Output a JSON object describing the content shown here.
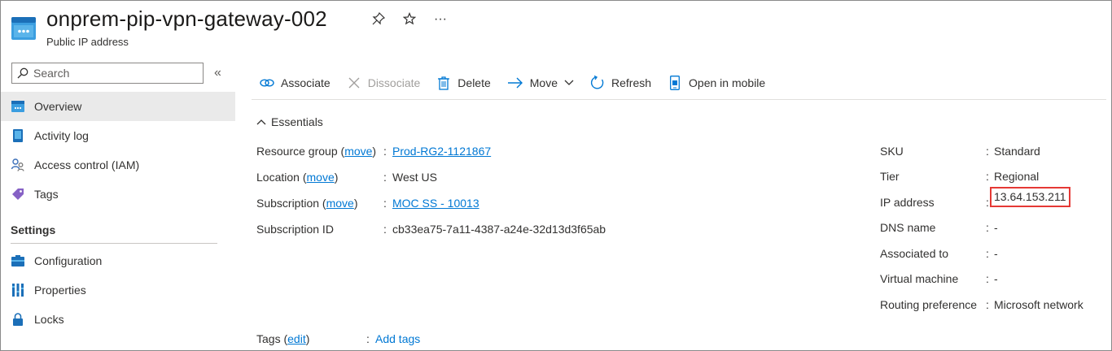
{
  "header": {
    "title": "onprem-pip-vpn-gateway-002",
    "subtitle": "Public IP address",
    "icons": [
      "pin-icon",
      "star-icon",
      "more-icon"
    ]
  },
  "sidebar": {
    "search_placeholder": "Search",
    "items": [
      {
        "label": "Overview",
        "icon": "overview-icon",
        "active": true
      },
      {
        "label": "Activity log",
        "icon": "activity-log-icon"
      },
      {
        "label": "Access control (IAM)",
        "icon": "iam-icon"
      },
      {
        "label": "Tags",
        "icon": "tag-icon"
      }
    ],
    "section_settings": "Settings",
    "settings_items": [
      {
        "label": "Configuration",
        "icon": "configuration-icon"
      },
      {
        "label": "Properties",
        "icon": "properties-icon"
      },
      {
        "label": "Locks",
        "icon": "lock-icon"
      }
    ]
  },
  "toolbar": {
    "associate": "Associate",
    "dissociate": "Dissociate",
    "delete": "Delete",
    "move": "Move",
    "refresh": "Refresh",
    "open_mobile": "Open in mobile"
  },
  "essentials": {
    "label": "Essentials",
    "left": {
      "resource_group_label": "Resource group",
      "resource_group_move": "move",
      "resource_group_value": "Prod-RG2-1121867",
      "location_label": "Location",
      "location_move": "move",
      "location_value": "West US",
      "subscription_label": "Subscription",
      "subscription_move": "move",
      "subscription_value": "MOC SS - 10013",
      "subscription_id_label": "Subscription ID",
      "subscription_id_value": "cb33ea75-7a11-4387-a24e-32d13d3f65ab"
    },
    "right": {
      "sku_label": "SKU",
      "sku_value": "Standard",
      "tier_label": "Tier",
      "tier_value": "Regional",
      "ip_label": "IP address",
      "ip_value": "13.64.153.211",
      "dns_label": "DNS name",
      "dns_value": "-",
      "associated_label": "Associated to",
      "associated_value": "-",
      "vm_label": "Virtual machine",
      "vm_value": "-",
      "routing_label": "Routing preference",
      "routing_value": "Microsoft network"
    },
    "tags_label": "Tags",
    "tags_edit": "edit",
    "tags_value": "Add tags"
  },
  "colors": {
    "link": "#0078d4",
    "highlight": "#e53935",
    "active_nav": "#eaeaea"
  }
}
